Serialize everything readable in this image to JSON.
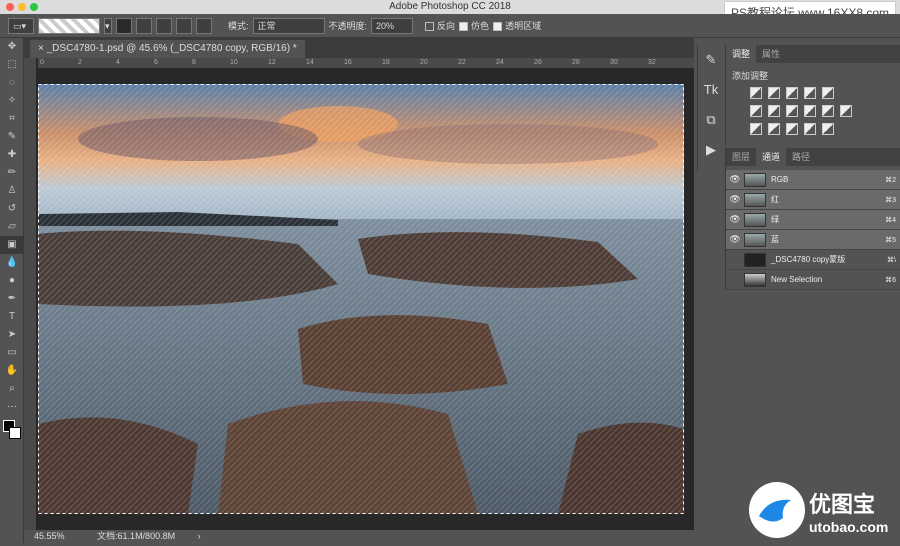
{
  "app_title": "Adobe Photoshop CC 2018",
  "watermark": "PS教程论坛 www.16XX8.com",
  "options": {
    "mode_label": "模式:",
    "mode_value": "正常",
    "opacity_label": "不透明度:",
    "opacity_value": "20%",
    "reverse_label": "反向",
    "dither_label": "仿色",
    "transparency_label": "透明区域"
  },
  "document_tab": "_DSC4780-1.psd @ 45.6% (_DSC4780 copy, RGB/16) *",
  "ruler_ticks": [
    "0",
    "2",
    "4",
    "6",
    "8",
    "10",
    "12",
    "14",
    "16",
    "18",
    "20",
    "22",
    "24",
    "26",
    "28",
    "30",
    "32"
  ],
  "status": {
    "zoom": "45.55%",
    "doc_info": "文档:61.1M/800.8M"
  },
  "adjust_panel": {
    "tab_adjust": "调整",
    "tab_properties": "属性",
    "add_adjustment": "添加调整"
  },
  "channels_panel": {
    "tab_layers": "图层",
    "tab_channels": "通道",
    "tab_paths": "路径",
    "rows": [
      {
        "name": "RGB",
        "key": "⌘2",
        "visible": true
      },
      {
        "name": "红",
        "key": "⌘3",
        "visible": true
      },
      {
        "name": "绿",
        "key": "⌘4",
        "visible": true
      },
      {
        "name": "蓝",
        "key": "⌘5",
        "visible": true
      },
      {
        "name": "_DSC4780 copy蒙版",
        "key": "⌘\\",
        "visible": false
      },
      {
        "name": "New Selection",
        "key": "⌘6",
        "visible": false
      }
    ]
  },
  "logo": {
    "text_cn": "优图宝",
    "text_url": "utobao.com"
  },
  "colors": {
    "accent_blue": "#1e88e5",
    "panel_bg": "#535353",
    "canvas_bg": "#282828"
  }
}
